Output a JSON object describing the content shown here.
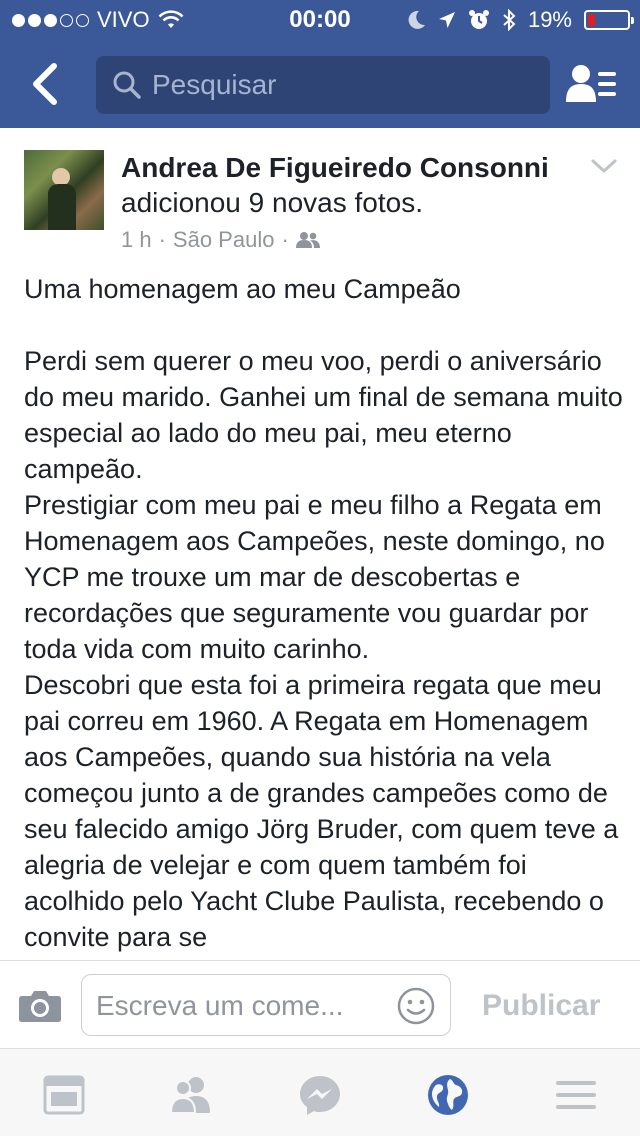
{
  "status_bar": {
    "carrier": "VIVO",
    "time": "00:00",
    "battery_percent": "19%",
    "signal_filled_dots": 3,
    "signal_total_dots": 5,
    "battery_level": 0.19,
    "icons": [
      "signal-dots-icon",
      "wifi-icon",
      "moon-icon",
      "location-arrow-icon",
      "alarm-icon",
      "bluetooth-icon",
      "battery-icon"
    ]
  },
  "nav": {
    "back_icon": "chevron-left-icon",
    "search_placeholder": "Pesquisar",
    "search_icon": "search-icon",
    "friend_requests_icon": "friend-requests-icon"
  },
  "post": {
    "author": "Andrea De Figueiredo Consonni",
    "action": "adicionou 9 novas fotos.",
    "time": "1 h",
    "location": "São Paulo",
    "separator": "·",
    "privacy_icon": "friends-audience-icon",
    "options_icon": "chevron-down-icon",
    "paragraphs": [
      "Uma homenagem ao meu Campeão",
      "",
      "Perdi sem querer o meu voo, perdi o aniversário do meu marido. Ganhei um final de semana muito especial ao lado do meu pai, meu eterno campeão.",
      "Prestigiar com meu pai e meu filho a Regata em Homenagem aos Campeões, neste domingo, no YCP me trouxe um mar de descobertas e recordações que seguramente vou guardar por toda vida com muito carinho.",
      "Descobri que esta foi a primeira regata que meu pai correu em 1960. A Regata em Homenagem aos Campeões, quando sua história na vela começou junto a de grandes campeões como de seu falecido amigo Jörg Bruder, com quem teve a alegria de velejar e com quem também foi acolhido pelo Yacht Clube Paulista, recebendo o convite para se"
    ]
  },
  "comment_bar": {
    "camera_icon": "camera-icon",
    "placeholder": "Escreva um come...",
    "emoji_icon": "smiley-icon",
    "publish_label": "Publicar"
  },
  "tabbar": {
    "tabs": [
      {
        "name": "news-feed",
        "icon": "news-feed-icon",
        "active": false
      },
      {
        "name": "friends",
        "icon": "friends-icon",
        "active": false
      },
      {
        "name": "messenger",
        "icon": "messenger-icon",
        "active": false
      },
      {
        "name": "notifications",
        "icon": "globe-icon",
        "active": true
      },
      {
        "name": "more",
        "icon": "menu-icon",
        "active": false
      }
    ]
  },
  "colors": {
    "brand_blue": "#3b5998",
    "search_bg": "#2d4475",
    "active_tab": "#4267b2",
    "inactive_tab": "#bec3c9",
    "meta_gray": "#90949c",
    "battery_low": "#e02020"
  }
}
